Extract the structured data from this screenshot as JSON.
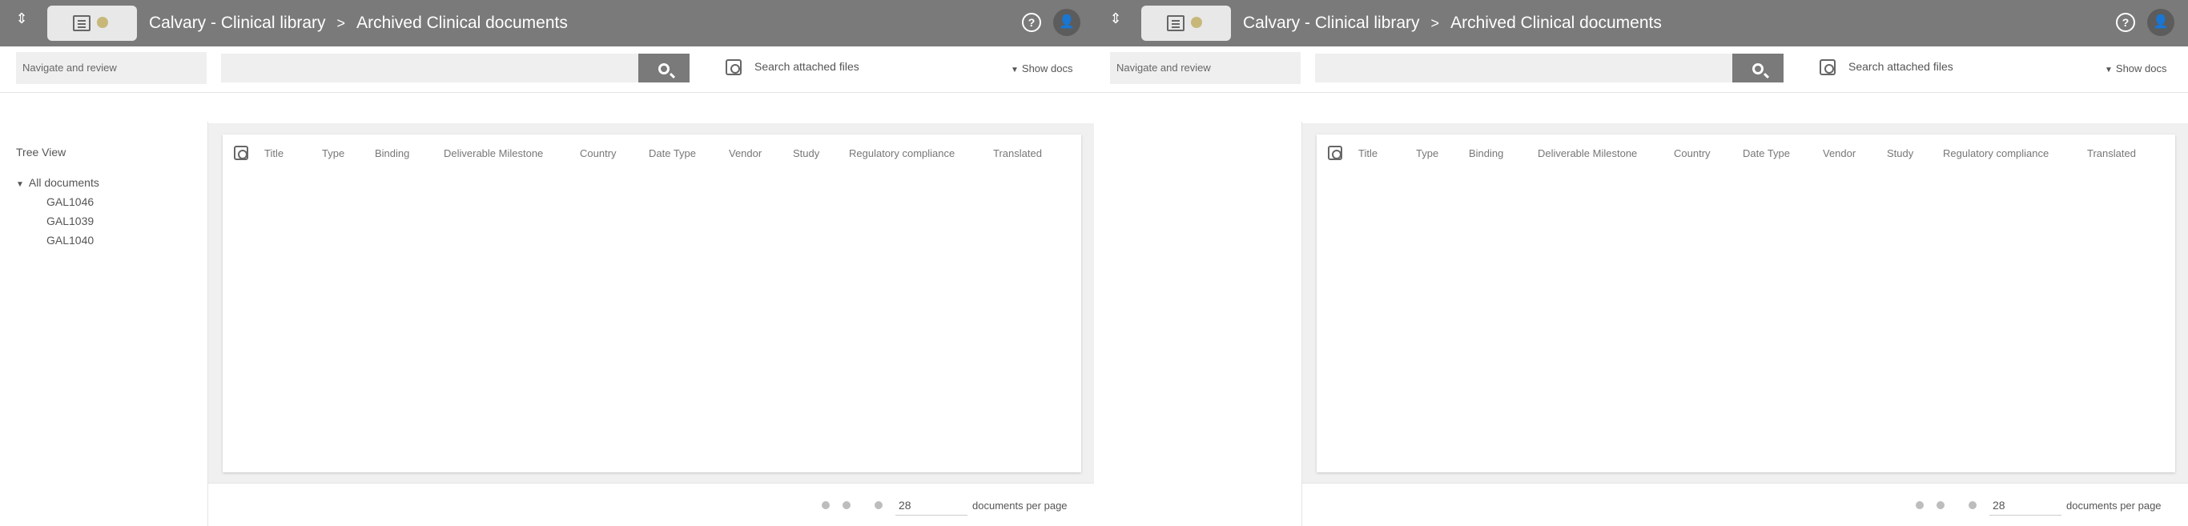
{
  "header": {
    "breadcrumb": [
      {
        "label": "Calvary - Clinical library"
      },
      {
        "label": "Archived Clinical documents"
      }
    ],
    "separator": ">"
  },
  "toolbar": {
    "tree_label": "Navigate and review",
    "search_value": "",
    "attach_label": "Search attached files",
    "show_label": "Show docs"
  },
  "tree": {
    "header": "Tree View",
    "root_label": "All documents",
    "items": [
      {
        "label": "GAL1046"
      },
      {
        "label": "GAL1039"
      },
      {
        "label": "GAL1040"
      }
    ]
  },
  "grid": {
    "columns": [
      {
        "label": "Title"
      },
      {
        "label": "Type"
      },
      {
        "label": "Binding"
      },
      {
        "label": "Deliverable Milestone"
      },
      {
        "label": "Country"
      },
      {
        "label": "Date Type"
      },
      {
        "label": "Vendor"
      },
      {
        "label": "Study"
      },
      {
        "label": "Regulatory compliance"
      },
      {
        "label": "Translated"
      }
    ]
  },
  "pager": {
    "per_page_value": "28",
    "per_page_label": "documents per page"
  }
}
